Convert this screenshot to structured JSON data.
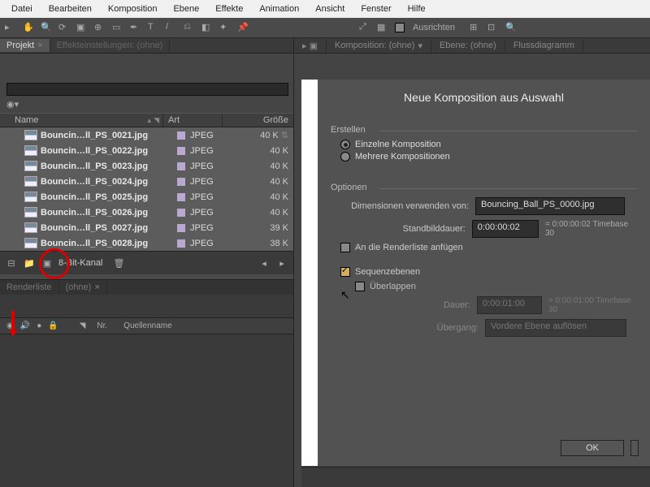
{
  "menu": {
    "items": [
      "Datei",
      "Bearbeiten",
      "Komposition",
      "Ebene",
      "Effekte",
      "Animation",
      "Ansicht",
      "Fenster",
      "Hilfe"
    ]
  },
  "toolbar": {
    "ausrichten": "Ausrichten"
  },
  "project": {
    "tab": "Projekt",
    "tab2": "Effekteinstellungen: (ohne)",
    "columns": {
      "name": "Name",
      "art": "Art",
      "size": "Größe"
    },
    "files": [
      {
        "name": "Bouncin…ll_PS_0021.jpg",
        "type": "JPEG",
        "size": "40 K"
      },
      {
        "name": "Bouncin…ll_PS_0022.jpg",
        "type": "JPEG",
        "size": "40 K"
      },
      {
        "name": "Bouncin…ll_PS_0023.jpg",
        "type": "JPEG",
        "size": "40 K"
      },
      {
        "name": "Bouncin…ll_PS_0024.jpg",
        "type": "JPEG",
        "size": "40 K"
      },
      {
        "name": "Bouncin…ll_PS_0025.jpg",
        "type": "JPEG",
        "size": "40 K"
      },
      {
        "name": "Bouncin…ll_PS_0026.jpg",
        "type": "JPEG",
        "size": "40 K"
      },
      {
        "name": "Bouncin…ll_PS_0027.jpg",
        "type": "JPEG",
        "size": "39 K"
      },
      {
        "name": "Bouncin…ll_PS_0028.jpg",
        "type": "JPEG",
        "size": "38 K"
      }
    ],
    "footer": {
      "bitdepth": "8-Bit-Kanal"
    }
  },
  "comp_tabs": {
    "a": "Komposition: (ohne)",
    "b": "Ebene: (ohne)",
    "c": "Flussdiagramm"
  },
  "timeline": {
    "tab1": "Renderliste",
    "tab2": "(ohne)",
    "nr": "Nr.",
    "quelle": "Quellenname"
  },
  "dialog": {
    "title": "Neue Komposition aus Auswahl",
    "erstellen": "Erstellen",
    "r1": "Einzelne Komposition",
    "r2": "Mehrere Kompositionen",
    "optionen": "Optionen",
    "dim_label": "Dimensionen verwenden von:",
    "dim_value": "Bouncing_Ball_PS_0000.jpg",
    "still_label": "Standbilddauer:",
    "still_value": "0:00:00:02",
    "still_after": "= 0:00:00:02  Timebase 30",
    "renderlist": "An die Renderliste anfügen",
    "seq": "Sequenzebenen",
    "overlap": "Überlappen",
    "dauer_label": "Dauer:",
    "dauer_value": "0:00:01:00",
    "dauer_after": "= 0:00:01:00  Timebase 30",
    "uebergang_label": "Übergang:",
    "uebergang_value": "Vordere Ebene auflösen",
    "ok": "OK"
  }
}
